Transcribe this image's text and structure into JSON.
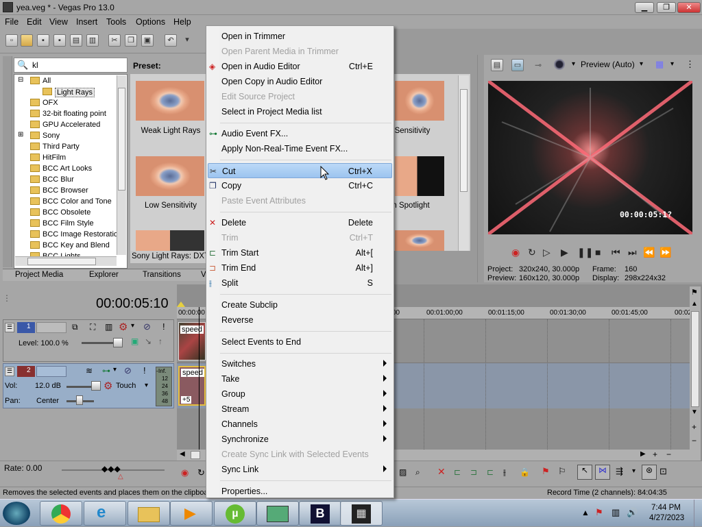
{
  "window": {
    "title": "yea.veg * - Vegas Pro 13.0",
    "min": "▁",
    "max": "❐",
    "close": "✕"
  },
  "menubar": [
    "File",
    "Edit",
    "View",
    "Insert",
    "Tools",
    "Options",
    "Help"
  ],
  "search": {
    "value": "kl"
  },
  "tree": [
    {
      "label": "All",
      "indent": 1,
      "expander": "⊟"
    },
    {
      "label": "Light Rays",
      "indent": 2,
      "selected": true
    },
    {
      "label": "OFX",
      "indent": 1
    },
    {
      "label": "32-bit floating point",
      "indent": 1
    },
    {
      "label": "GPU Accelerated",
      "indent": 1
    },
    {
      "label": "Sony",
      "indent": 1,
      "expander": "⊞"
    },
    {
      "label": "Third Party",
      "indent": 1
    },
    {
      "label": "HitFilm",
      "indent": 1
    },
    {
      "label": "BCC Art Looks",
      "indent": 1
    },
    {
      "label": "BCC Blur",
      "indent": 1
    },
    {
      "label": "BCC Browser",
      "indent": 1
    },
    {
      "label": "BCC Color and Tone",
      "indent": 1
    },
    {
      "label": "BCC Obsolete",
      "indent": 1
    },
    {
      "label": "BCC Film Style",
      "indent": 1
    },
    {
      "label": "BCC Image Restoratio",
      "indent": 1
    },
    {
      "label": "BCC Key and Blend",
      "indent": 1
    },
    {
      "label": "BCC Lights",
      "indent": 1
    }
  ],
  "preset": {
    "header": "Preset:",
    "items": [
      "Weak Light Rays",
      "Low Sensitivity",
      "h Sensitivity",
      "an Spotlight"
    ],
    "footer": "Sony Light Rays: DXT"
  },
  "left_tabs": [
    "Project Media",
    "Explorer",
    "Transitions",
    "V"
  ],
  "timecode": "00:00:05:10",
  "track1": {
    "number": "1",
    "level": "Level: 100.0 %"
  },
  "track2": {
    "number": "2",
    "vol_label": "Vol:",
    "vol_value": "12.0 dB",
    "pan_label": "Pan:",
    "pan_value": "Center",
    "mode": "Touch",
    "meter_top": "-Inf.",
    "meter_vals": [
      "12",
      "24",
      "36",
      "48"
    ]
  },
  "clips": {
    "label1": "speed",
    "label2": "speed",
    "plus": "+5"
  },
  "ruler": [
    "00:00:00",
    "00",
    "00:01:00;00",
    "00:01:15;00",
    "00:01:30;00",
    "00:01:45;00",
    "00:02"
  ],
  "rate": "Rate: 0.00",
  "preview": {
    "mode": "Preview (Auto)",
    "overlay_time": "00:00:05:1?",
    "project_label": "Project:",
    "project_value": "320x240, 30.000p",
    "preview_label": "Preview:",
    "preview_value": "160x120, 30.000p",
    "frame_label": "Frame:",
    "frame_value": "160",
    "display_label": "Display:",
    "display_value": "298x224x32"
  },
  "context_menu": [
    {
      "label": "Open in Trimmer",
      "shortcut": "",
      "disabled": false
    },
    {
      "label": "Open Parent Media in Trimmer",
      "shortcut": "",
      "disabled": true
    },
    {
      "label": "Open in Audio Editor",
      "shortcut": "Ctrl+E",
      "disabled": false,
      "icon": "audio-editor-icon"
    },
    {
      "label": "Open Copy in Audio Editor",
      "shortcut": "",
      "disabled": false
    },
    {
      "label": "Edit Source Project",
      "shortcut": "",
      "disabled": true
    },
    {
      "label": "Select in Project Media list",
      "shortcut": "",
      "disabled": false
    },
    {
      "sep": true
    },
    {
      "label": "Audio Event FX...",
      "shortcut": "",
      "disabled": false,
      "icon": "fx-icon"
    },
    {
      "label": "Apply Non-Real-Time Event FX...",
      "shortcut": "",
      "disabled": false
    },
    {
      "sep": true
    },
    {
      "label": "Cut",
      "shortcut": "Ctrl+X",
      "disabled": false,
      "highlight": true,
      "icon": "scissors-icon"
    },
    {
      "label": "Copy",
      "shortcut": "Ctrl+C",
      "disabled": false,
      "icon": "copy-icon"
    },
    {
      "label": "Paste Event Attributes",
      "shortcut": "",
      "disabled": true
    },
    {
      "sep": true
    },
    {
      "label": "Delete",
      "shortcut": "Delete",
      "disabled": false,
      "icon": "delete-icon"
    },
    {
      "label": "Trim",
      "shortcut": "Ctrl+T",
      "disabled": true
    },
    {
      "label": "Trim Start",
      "shortcut": "Alt+[",
      "disabled": false,
      "icon": "trim-start-icon"
    },
    {
      "label": "Trim End",
      "shortcut": "Alt+]",
      "disabled": false,
      "icon": "trim-end-icon"
    },
    {
      "label": "Split",
      "shortcut": "S",
      "disabled": false,
      "icon": "split-icon"
    },
    {
      "sep": true
    },
    {
      "label": "Create Subclip",
      "shortcut": "",
      "disabled": false
    },
    {
      "label": "Reverse",
      "shortcut": "",
      "disabled": false
    },
    {
      "sep": true
    },
    {
      "label": "Select Events to End",
      "shortcut": "",
      "disabled": false
    },
    {
      "sep": true
    },
    {
      "label": "Switches",
      "submenu": true
    },
    {
      "label": "Take",
      "submenu": true
    },
    {
      "label": "Group",
      "submenu": true
    },
    {
      "label": "Stream",
      "submenu": true
    },
    {
      "label": "Channels",
      "submenu": true
    },
    {
      "label": "Synchronize",
      "submenu": true
    },
    {
      "label": "Create Sync Link with Selected Events",
      "disabled": true
    },
    {
      "label": "Sync Link",
      "submenu": true
    },
    {
      "sep": true
    },
    {
      "label": "Properties...",
      "shortcut": "",
      "disabled": false
    }
  ],
  "status": {
    "left": "Removes the selected events and places them on the clipboar",
    "right": "Record Time (2 channels): 84:04:35"
  },
  "clock": {
    "time": "7:44 PM",
    "date": "4/27/2023"
  },
  "colors": {
    "accent": "#9cc4ef",
    "track2": "#98aec8",
    "ray": "#ff6b78"
  }
}
